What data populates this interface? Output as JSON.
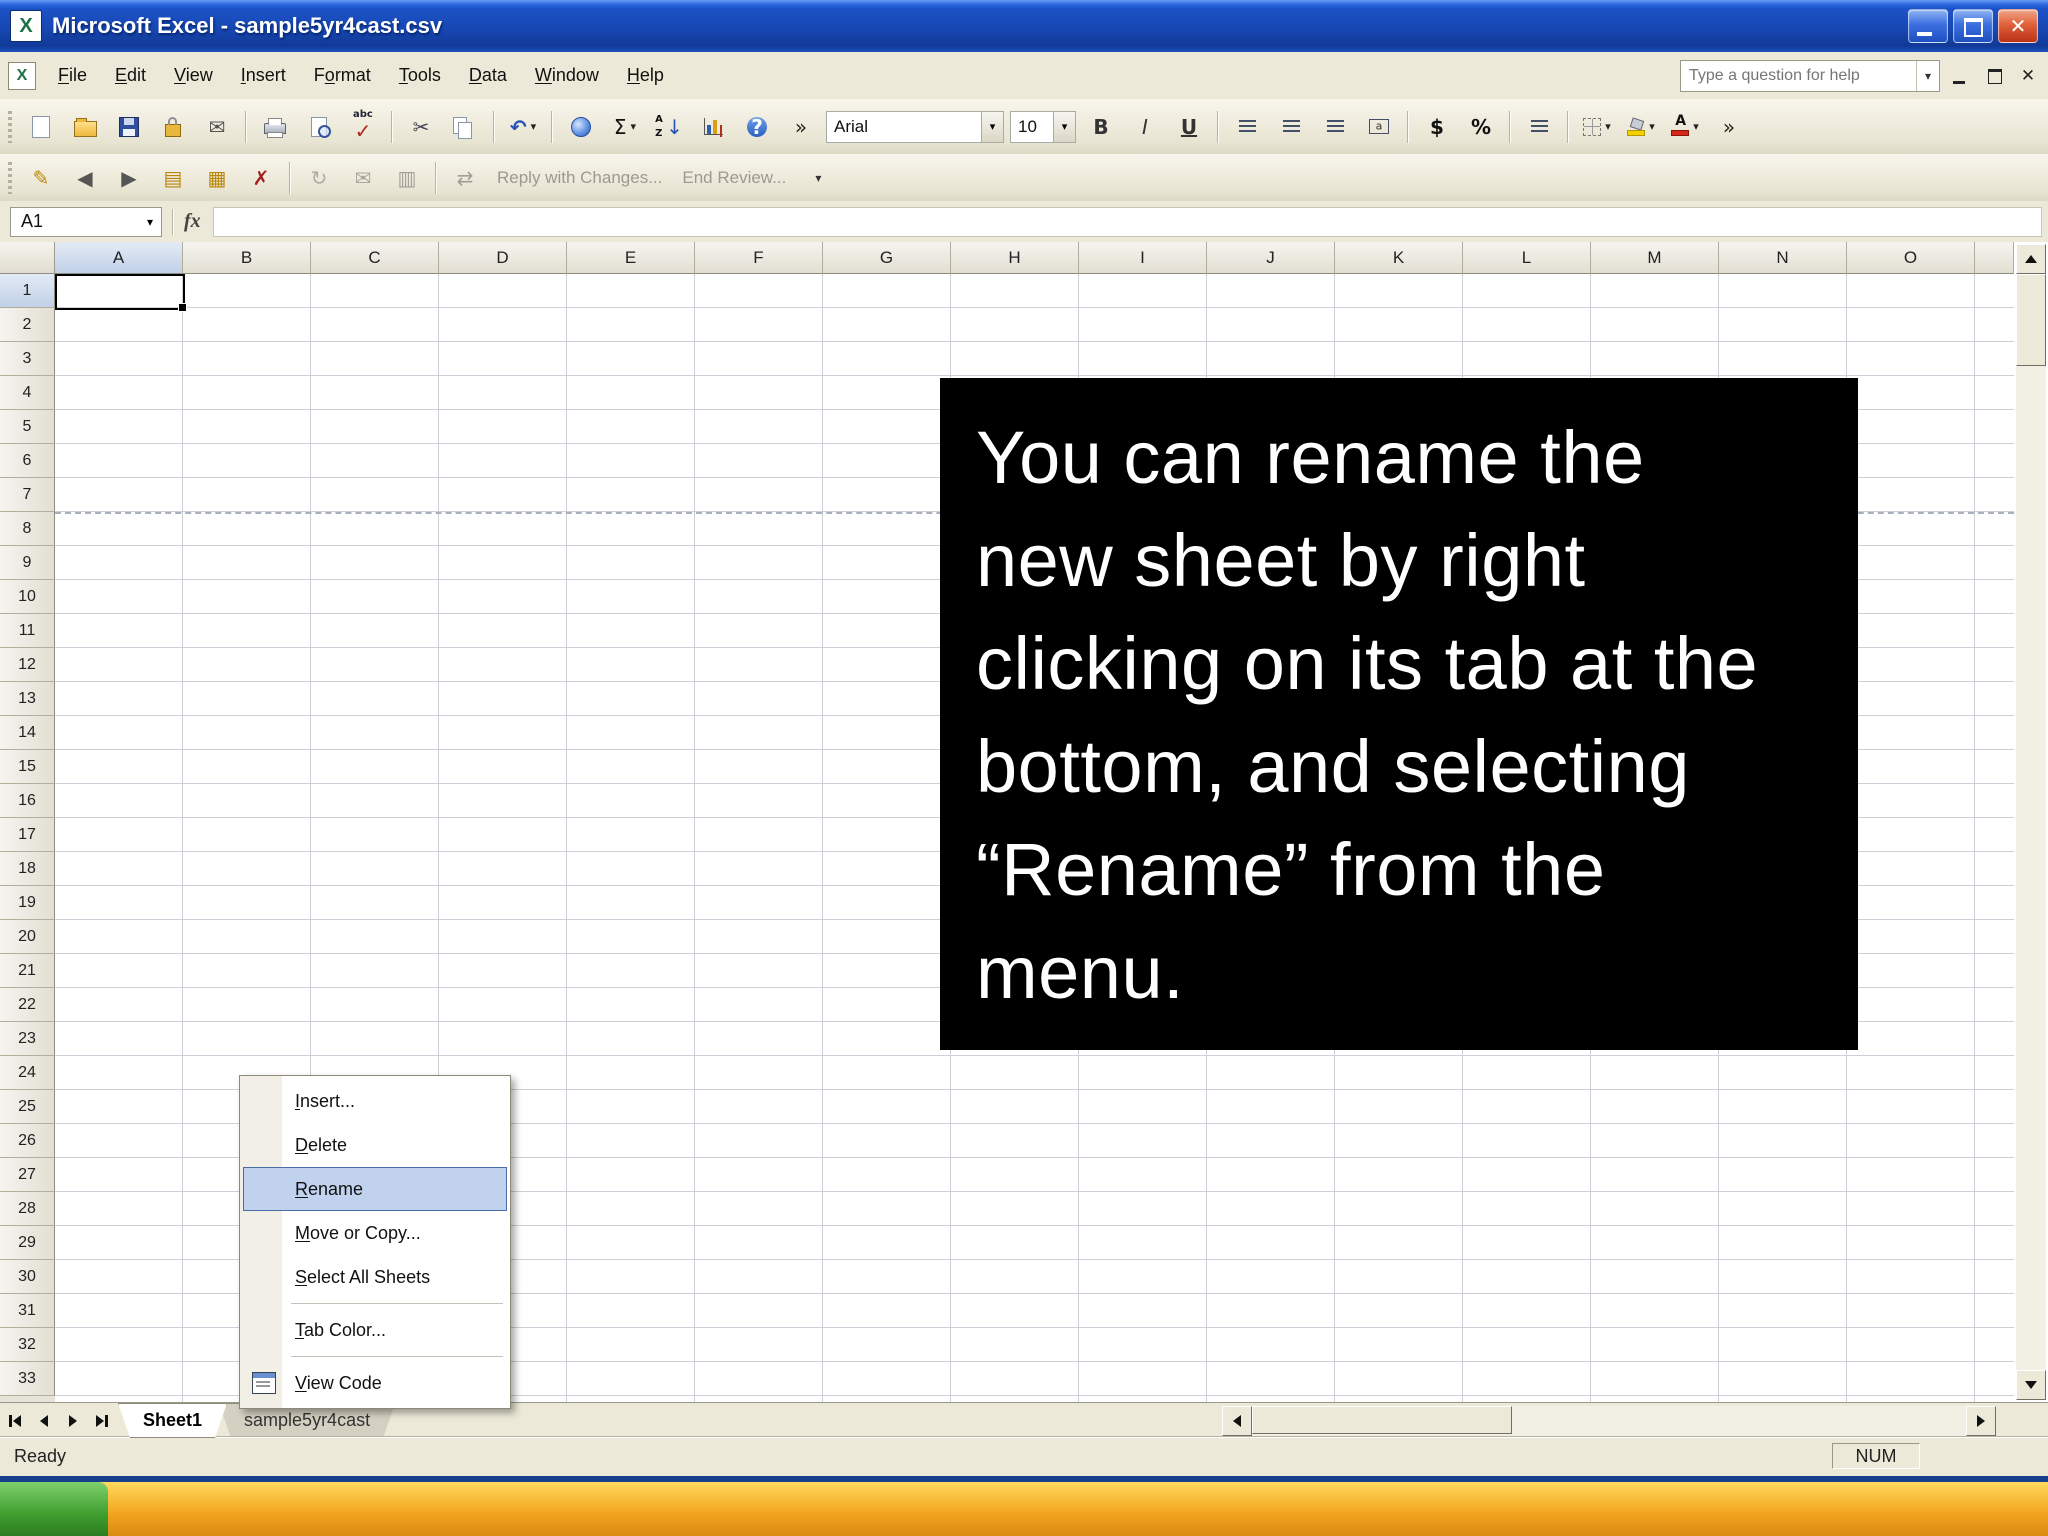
{
  "window_title": "Microsoft Excel - sample5yr4cast.csv",
  "menu": {
    "help_placeholder": "Type a question for help",
    "items": [
      {
        "label": "File",
        "accel": "F"
      },
      {
        "label": "Edit",
        "accel": "E"
      },
      {
        "label": "View",
        "accel": "V"
      },
      {
        "label": "Insert",
        "accel": "I"
      },
      {
        "label": "Format",
        "accel": "o"
      },
      {
        "label": "Tools",
        "accel": "T"
      },
      {
        "label": "Data",
        "accel": "D"
      },
      {
        "label": "Window",
        "accel": "W"
      },
      {
        "label": "Help",
        "accel": "H"
      }
    ]
  },
  "toolbar_standard": {
    "buttons": [
      {
        "name": "new",
        "glyph": ""
      },
      {
        "name": "open",
        "glyph": ""
      },
      {
        "name": "save",
        "glyph": ""
      },
      {
        "name": "permission",
        "glyph": ""
      },
      {
        "name": "mail",
        "glyph": "✉"
      },
      {
        "sep": true
      },
      {
        "name": "print",
        "glyph": ""
      },
      {
        "name": "print-preview",
        "glyph": ""
      },
      {
        "name": "spelling",
        "glyph": "✓"
      },
      {
        "sep": true
      },
      {
        "name": "cut",
        "glyph": "✂"
      },
      {
        "name": "copy",
        "glyph": ""
      },
      {
        "sep": true
      },
      {
        "name": "undo",
        "glyph": "↶",
        "dd": true
      },
      {
        "sep": true
      },
      {
        "name": "hyperlink",
        "glyph": ""
      },
      {
        "name": "autosum",
        "glyph": "Σ",
        "dd": true
      },
      {
        "name": "sort-ascending",
        "glyph": "↓"
      },
      {
        "name": "chart-wizard",
        "glyph": ""
      },
      {
        "name": "help",
        "glyph": "?"
      },
      {
        "name": "toolbar-options",
        "glyph": "»"
      }
    ]
  },
  "toolbar_formatting": {
    "font_name": "Arial",
    "font_size": "10",
    "buttons": [
      {
        "name": "bold",
        "glyph": "B"
      },
      {
        "name": "italic",
        "glyph": "I"
      },
      {
        "name": "underline",
        "glyph": "U"
      },
      {
        "sep": true
      },
      {
        "name": "align-left",
        "glyph": ""
      },
      {
        "name": "align-center",
        "glyph": ""
      },
      {
        "name": "align-right",
        "glyph": ""
      },
      {
        "name": "merge-center",
        "glyph": ""
      },
      {
        "sep": true
      },
      {
        "name": "currency",
        "glyph": "$"
      },
      {
        "name": "percent",
        "glyph": "%"
      },
      {
        "sep": true
      },
      {
        "name": "increase-indent",
        "glyph": ""
      },
      {
        "sep": true
      },
      {
        "name": "borders",
        "glyph": "",
        "dd": true
      },
      {
        "name": "fill-color",
        "glyph": "",
        "dd": true
      },
      {
        "name": "font-color",
        "glyph": "",
        "dd": true
      },
      {
        "name": "toolbar-options",
        "glyph": "»"
      }
    ]
  },
  "toolbar_review": {
    "reply_label": "Reply with Changes...",
    "end_label": "End Review...",
    "buttons": [
      {
        "name": "edit-comment",
        "glyph": "✎"
      },
      {
        "name": "previous-comment",
        "glyph": "◀"
      },
      {
        "name": "next-comment",
        "glyph": "▶"
      },
      {
        "name": "show-comment",
        "glyph": "▤"
      },
      {
        "name": "show-all-comments",
        "glyph": "▦"
      },
      {
        "name": "delete-comment",
        "glyph": "✗"
      },
      {
        "sep": true
      },
      {
        "name": "update-file",
        "glyph": "↻",
        "disabled": true
      },
      {
        "name": "send-to-mail-recipient",
        "glyph": "✉",
        "disabled": true
      },
      {
        "name": "show-reviewing-pane",
        "glyph": "▥",
        "disabled": true
      },
      {
        "sep": true
      },
      {
        "name": "reply-with-changes",
        "glyph": "⇄",
        "disabled": true
      }
    ]
  },
  "formula_bar": {
    "cell_reference": "A1",
    "fx_label": "fx"
  },
  "grid": {
    "column_headers": [
      "A",
      "B",
      "C",
      "D",
      "E",
      "F",
      "G",
      "H",
      "I",
      "J",
      "K",
      "L",
      "M",
      "N",
      "O"
    ],
    "row_count": 33,
    "selected_cell": "A1"
  },
  "caption_overlay": {
    "lines": [
      "You can rename the",
      "new sheet by right",
      "clicking on its tab at the",
      "bottom, and selecting",
      "“Rename” from the",
      "menu."
    ]
  },
  "context_menu": {
    "items": [
      {
        "label": "Insert...",
        "accel": "I"
      },
      {
        "label": "Delete",
        "accel": "D"
      },
      {
        "label": "Rename",
        "accel": "R",
        "highlighted": true
      },
      {
        "label": "Move or Copy...",
        "accel": "M"
      },
      {
        "label": "Select All Sheets",
        "accel": "S"
      },
      {
        "sep": true
      },
      {
        "label": "Tab Color...",
        "accel": "T"
      },
      {
        "sep": true
      },
      {
        "label": "View Code",
        "accel": "V",
        "icon": "vba"
      }
    ]
  },
  "sheet_tabs": [
    {
      "label": "Sheet1",
      "active": true
    },
    {
      "label": "sample5yr4cast",
      "active": false
    }
  ],
  "status_bar": {
    "ready": "Ready",
    "num": "NUM"
  }
}
